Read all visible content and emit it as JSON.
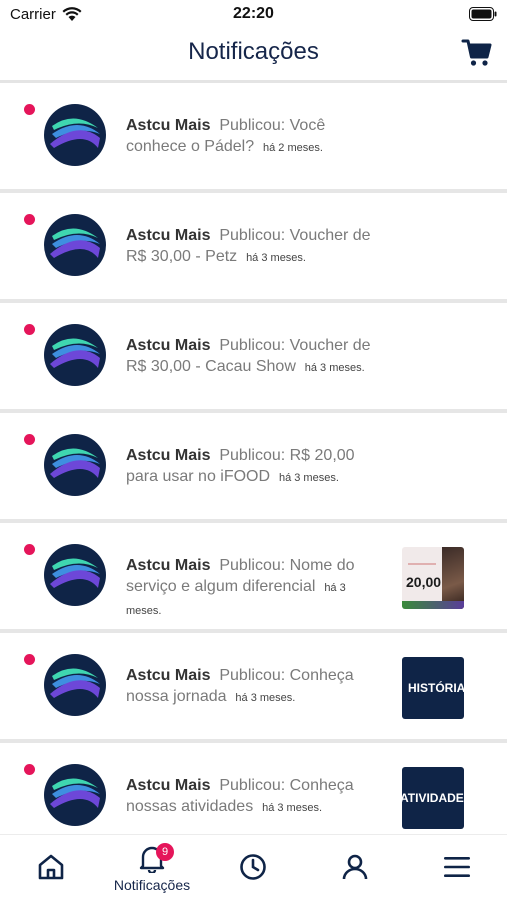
{
  "status_bar": {
    "carrier": "Carrier",
    "time": "22:20"
  },
  "header": {
    "title": "Notificações"
  },
  "notifications": [
    {
      "sender": "Astcu Mais",
      "message": "Publicou: Você conhece o Pádel?",
      "ago": "há 2 meses.",
      "unread": true
    },
    {
      "sender": "Astcu Mais",
      "message": "Publicou: Voucher de R$ 30,00 - Petz",
      "ago": "há 3 meses.",
      "unread": true
    },
    {
      "sender": "Astcu Mais",
      "message": "Publicou: Voucher de R$ 30,00 - Cacau Show",
      "ago": "há 3 meses.",
      "unread": true
    },
    {
      "sender": "Astcu Mais",
      "message": "Publicou: R$ 20,00 para usar no iFOOD",
      "ago": "há 3 meses.",
      "unread": true
    },
    {
      "sender": "Astcu Mais",
      "message": "Publicou: Nome do serviço e algum diferencial",
      "ago": "há 3 meses.",
      "unread": true,
      "thumbnail_text": "20,00"
    },
    {
      "sender": "Astcu Mais",
      "message": "Publicou: Conheça nossa jornada",
      "ago": "há 3 meses.",
      "unread": true,
      "thumbnail_text": "HISTÓRIA"
    },
    {
      "sender": "Astcu Mais",
      "message": "Publicou: Conheça nossas atividades",
      "ago": "há 3 meses.",
      "unread": true,
      "thumbnail_text": "ATIVIDADE"
    }
  ],
  "tab_bar": {
    "active_label": "Notificações",
    "badge_count": "9",
    "tabs": [
      "home-icon",
      "bell-icon",
      "clock-icon",
      "user-icon",
      "menu-icon"
    ]
  },
  "colors": {
    "accent": "#e5155a",
    "brand_navy": "#0f2447",
    "title": "#16264a"
  }
}
